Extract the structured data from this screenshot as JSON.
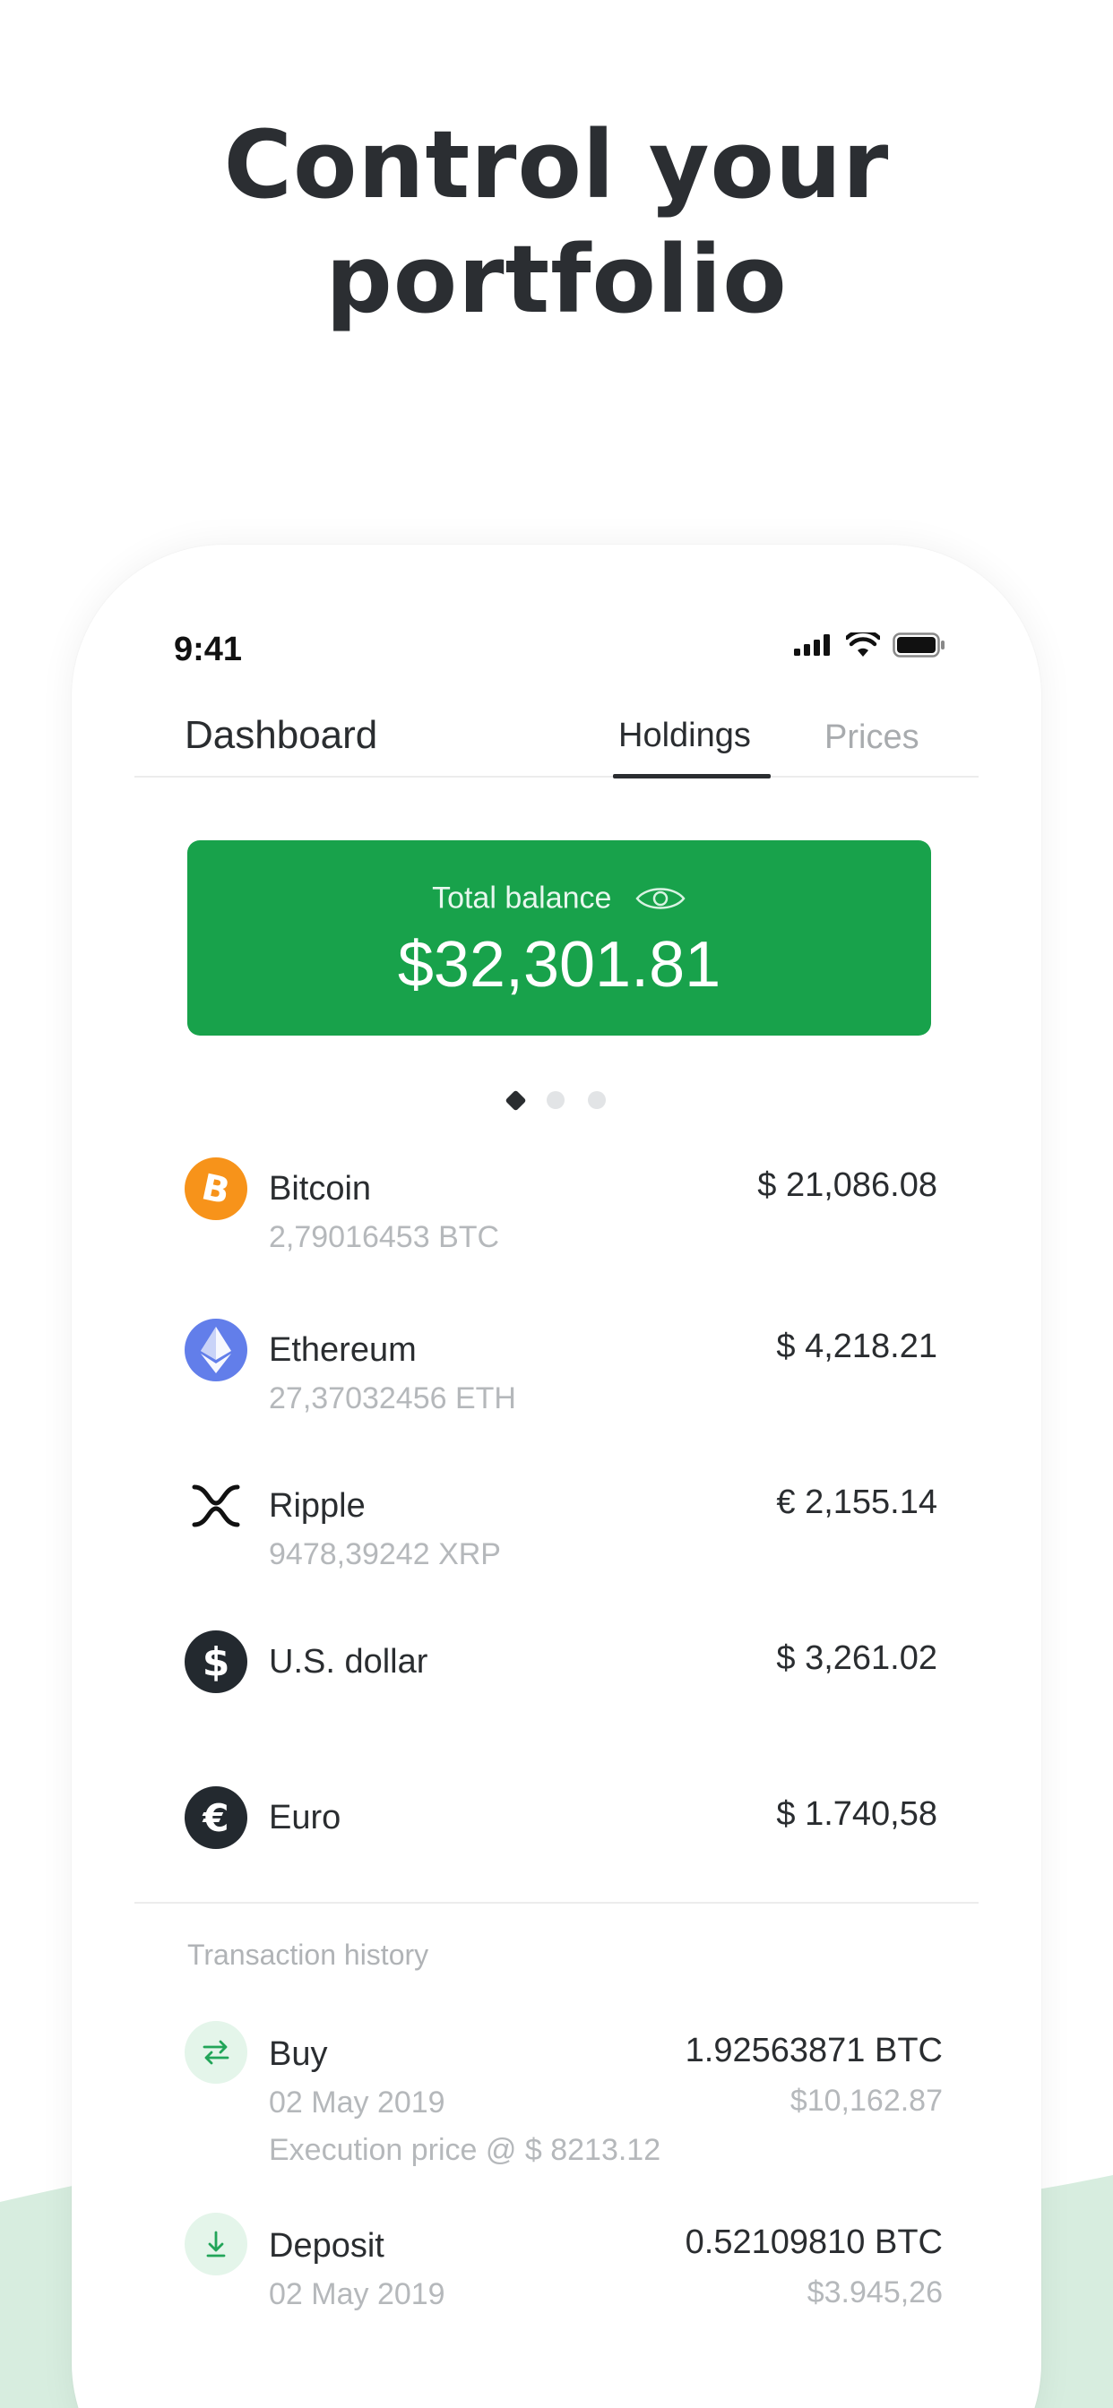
{
  "headline": {
    "line1": "Control your",
    "line2": "portfolio"
  },
  "status_bar": {
    "time": "9:41"
  },
  "tabs": {
    "dashboard": "Dashboard",
    "holdings": "Holdings",
    "prices": "Prices"
  },
  "balance": {
    "label": "Total balance",
    "value": "$32,301.81"
  },
  "carousel": {
    "active_index": 0,
    "count": 3
  },
  "holdings": [
    {
      "name": "Bitcoin",
      "amount": "2,79016453 BTC",
      "value": "$ 21,086.08",
      "icon": "bitcoin-icon",
      "color": "#f7931a"
    },
    {
      "name": "Ethereum",
      "amount": "27,37032456 ETH",
      "value": "$ 4,218.21",
      "icon": "ethereum-icon",
      "color": "#627eea"
    },
    {
      "name": "Ripple",
      "amount": "9478,39242 XRP",
      "value": "€ 2,155.14",
      "icon": "ripple-icon",
      "color": "#23292f"
    },
    {
      "name": "U.S. dollar",
      "amount": "",
      "value": "$ 3,261.02",
      "icon": "dollar-icon",
      "color": "#23292f"
    },
    {
      "name": "Euro",
      "amount": "",
      "value": "$ 1.740,58",
      "icon": "euro-icon",
      "color": "#23292f"
    }
  ],
  "transactions": {
    "title": "Transaction history",
    "items": [
      {
        "type": "Buy",
        "date": "02 May 2019",
        "note": "Execution price @ $ 8213.12",
        "amount": "1.92563871 BTC",
        "fiat": "$10,162.87",
        "icon": "exchange-icon"
      },
      {
        "type": "Deposit",
        "date": "02 May 2019",
        "note": "",
        "amount": "0.52109810 BTC",
        "fiat": "$3.945,26",
        "icon": "download-icon"
      }
    ]
  },
  "colors": {
    "accent": "#18a24b",
    "text": "#2a2d30",
    "muted": "#b5b8bb",
    "wave": "#d7eddf"
  }
}
